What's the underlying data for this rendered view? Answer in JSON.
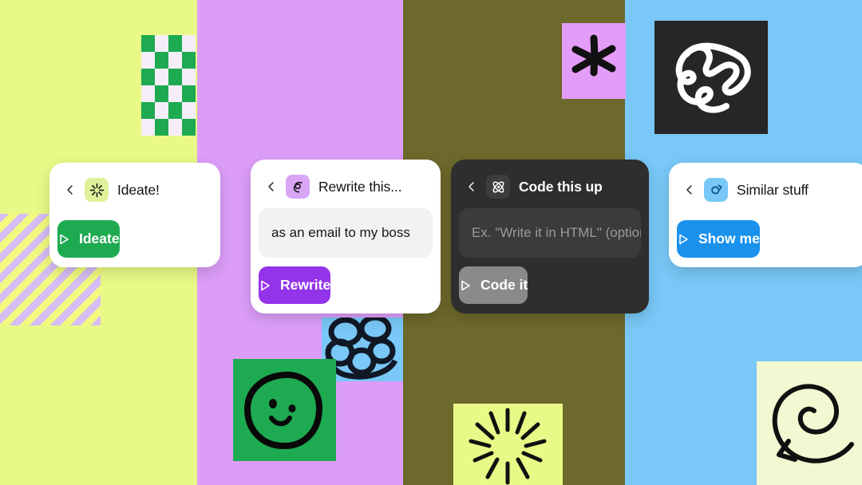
{
  "background": {
    "columns": [
      {
        "name": "column-yellow-green",
        "color": "#e9f987"
      },
      {
        "name": "column-lavender",
        "color": "#dc9df8"
      },
      {
        "name": "column-olive",
        "color": "#6d682b"
      },
      {
        "name": "column-sky-blue",
        "color": "#79c8f7"
      }
    ]
  },
  "decorations": [
    {
      "name": "diagonal-stripes-block",
      "colors": [
        "#d6bdf5",
        "#f1fa7e"
      ]
    },
    {
      "name": "checkerboard-block",
      "colors": [
        "#1eaa51",
        "#f5eef8"
      ],
      "columns": 4,
      "rows": 6
    },
    {
      "name": "asterisk-tile",
      "icon": "asterisk-icon",
      "tile_color": "#e39cf7",
      "ink": "#111111"
    },
    {
      "name": "blob-tile",
      "icon": "wavy-blob-icon",
      "tile_color": "#262626",
      "ink": "#ffffff"
    },
    {
      "name": "loops-tile",
      "icon": "circle-loops-icon",
      "tile_color": "#79c8f7",
      "ink": "#101826"
    },
    {
      "name": "smiley-tile",
      "icon": "smiley-face-icon",
      "tile_color": "#1eaa51",
      "ink": "#090909"
    },
    {
      "name": "burst-tile",
      "icon": "radial-burst-icon",
      "tile_color": "#e9f987",
      "ink": "#111111"
    },
    {
      "name": "spiral-tile",
      "icon": "spiral-arrow-icon",
      "tile_color": "#f3f7d2",
      "ink": "#111111"
    }
  ],
  "cards": {
    "ideate": {
      "theme": "light",
      "back_icon": "chevron-left-icon",
      "badge_icon": "sparkle-burst-icon",
      "badge_color": "#dff29a",
      "title": "Ideate!",
      "cta_label": "Ideate",
      "cta_color": "#1eaa51",
      "cta_icon": "play-icon"
    },
    "rewrite": {
      "theme": "light",
      "back_icon": "chevron-left-icon",
      "badge_icon": "squiggle-pen-icon",
      "badge_color": "#d9a6f5",
      "title": "Rewrite this...",
      "field_value": "as an email to my boss",
      "cta_label": "Rewrite",
      "cta_color": "#9333ea",
      "cta_icon": "play-icon"
    },
    "code": {
      "theme": "dark",
      "back_icon": "chevron-left-icon",
      "badge_icon": "atom-icon",
      "badge_color": "#3d3d3d",
      "title": "Code this up",
      "field_placeholder": "Ex. \"Write it in HTML\" (optional)",
      "cta_label": "Code it",
      "cta_color": "#8a8a8a",
      "cta_icon": "play-icon"
    },
    "similar": {
      "theme": "light",
      "back_icon": "chevron-left-icon",
      "badge_icon": "swirl-arrow-icon",
      "badge_color": "#79c8f7",
      "title": "Similar stuff",
      "cta_label": "Show me",
      "cta_color": "#1a91ec",
      "cta_icon": "play-icon"
    }
  }
}
